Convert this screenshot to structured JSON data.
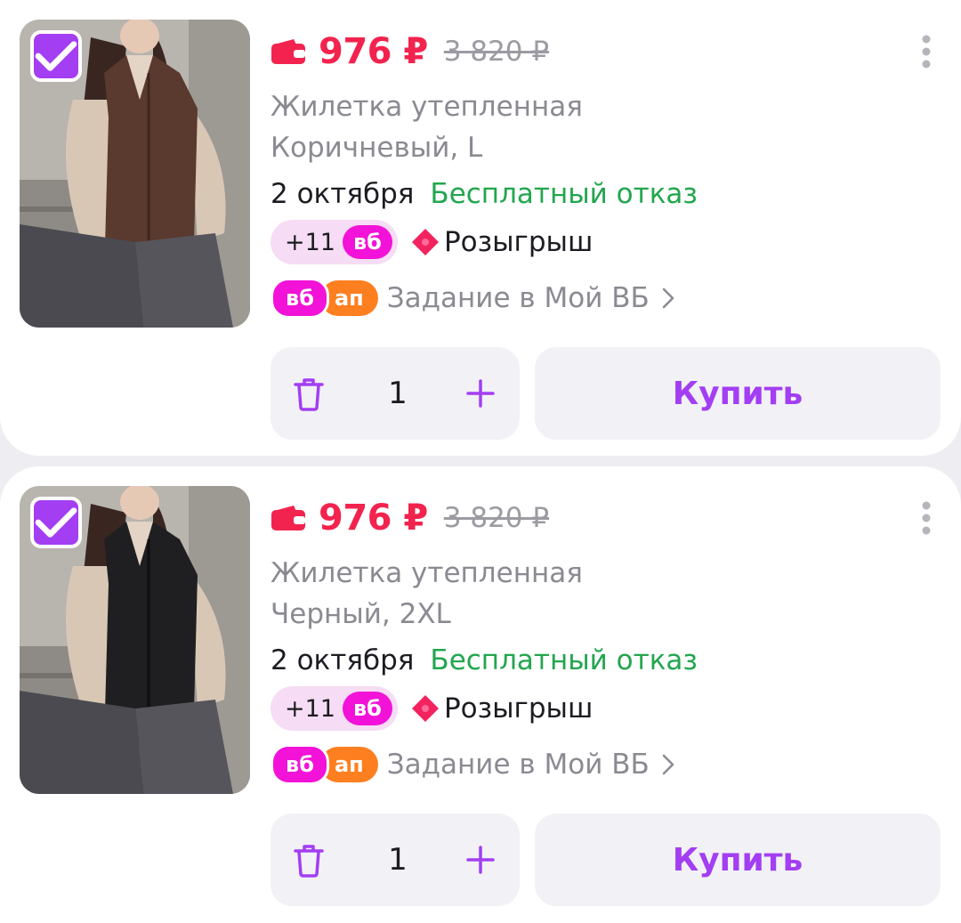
{
  "colors": {
    "accent": "#a33ef3",
    "price": "#f2234e",
    "refund": "#22a64e",
    "vb_badge": "#f212d8",
    "ap_badge": "#fe7f1f",
    "vest_brown": "#5a3a2e",
    "vest_black": "#1f1f22"
  },
  "items": [
    {
      "price_current": "976 ₽",
      "price_old": "3 820 ₽",
      "title": "Жилетка утепленная",
      "variant": "Коричневый, L",
      "delivery_date": "2 октября",
      "refund_label": "Бесплатный отказ",
      "points": "+11",
      "points_badge": "вб",
      "raffle_label": "Розыгрыш",
      "task_badge_vb": "вб",
      "task_badge_ap": "ап",
      "task_label": "Задание в Мой ВБ",
      "quantity": "1",
      "buy_label": "Купить",
      "selected": true,
      "image_icon": "product-photo-brown-vest"
    },
    {
      "price_current": "976 ₽",
      "price_old": "3 820 ₽",
      "title": "Жилетка утепленная",
      "variant": "Черный, 2XL",
      "delivery_date": "2 октября",
      "refund_label": "Бесплатный отказ",
      "points": "+11",
      "points_badge": "вб",
      "raffle_label": "Розыгрыш",
      "task_badge_vb": "вб",
      "task_badge_ap": "ап",
      "task_label": "Задание в Мой ВБ",
      "quantity": "1",
      "buy_label": "Купить",
      "selected": true,
      "image_icon": "product-photo-black-vest"
    }
  ]
}
